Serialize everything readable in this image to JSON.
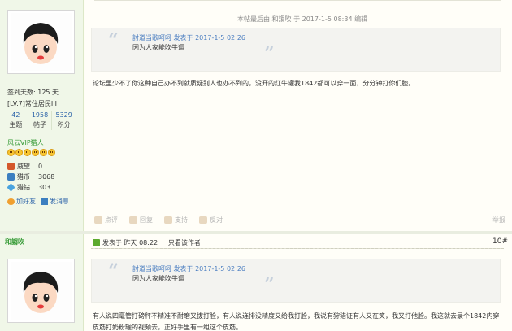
{
  "edit_note": "本帖最后由 和謅吹 于 2017-1-5 08:34 编辑",
  "quote1": {
    "head": "討道当歌呵呵 发表于 2017-1-5 02:26",
    "body": "因为人家能吹牛逼"
  },
  "post1_text": "论坛里少不了你这种自己办不到就质疑别人也办不到的，没开的红牛罐我1842都可以穿一面，分分钟打你们脸。",
  "sidebar": {
    "sign_days": "签到天数: 125 天",
    "rank": "[LV.7]常住居民III",
    "stats": [
      {
        "num": "42",
        "label": "主题"
      },
      {
        "num": "1958",
        "label": "帖子"
      },
      {
        "num": "5329",
        "label": "积分"
      }
    ],
    "vip": "风云VIP猎人",
    "kv": [
      {
        "k": "威望",
        "v": "0",
        "color": "#d4572a"
      },
      {
        "k": "猎币",
        "v": "3068",
        "color": "#3c7fc0"
      },
      {
        "k": "猎钻",
        "v": "303",
        "color": "#4aa3df"
      }
    ],
    "add_friend": "加好友",
    "send_msg": "发消息",
    "username2": "和謅吹"
  },
  "footer_actions": [
    "点评",
    "回复",
    "支持",
    "反对"
  ],
  "report": "举报",
  "post2": {
    "posted": "发表于 昨天 08:22",
    "only_author": "只看该作者",
    "floor": "10#"
  },
  "quote2": {
    "head": "討道当歌呵呵 发表于 2017-1-5 02:26",
    "body": "因为人家能吹牛逼"
  },
  "post2_text": "有人说四毫管打磅秤不精准不耐磨又拔打脸，有人说连排没精度又给我打脸，我说有狩猎证有人又在笑，我又打他脸。我这就去录个1842内穿皮筋打奶粉罐的视频去，正好手里有一组这个皮筋。"
}
